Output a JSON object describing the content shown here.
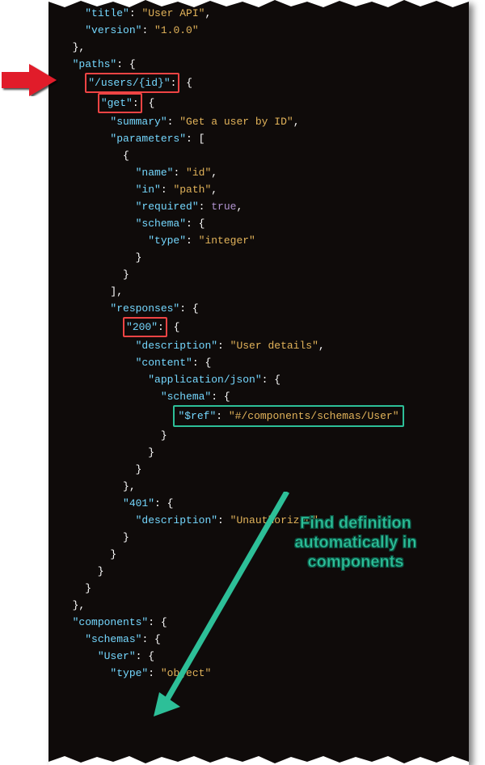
{
  "annotation": "Find definition\nautomatically in\ncomponents",
  "code_lines": [
    [
      [
        "p",
        "    "
      ],
      [
        "k",
        "\"title\""
      ],
      [
        "p",
        ": "
      ],
      [
        "s",
        "\"User API\""
      ],
      [
        "p",
        ","
      ]
    ],
    [
      [
        "p",
        "    "
      ],
      [
        "k",
        "\"version\""
      ],
      [
        "p",
        ": "
      ],
      [
        "s",
        "\"1.0.0\""
      ]
    ],
    [
      [
        "p",
        "  },"
      ]
    ],
    [
      [
        "p",
        "  "
      ],
      [
        "k",
        "\"paths\""
      ],
      [
        "p",
        ": {"
      ]
    ],
    [
      [
        "p",
        "    "
      ],
      [
        "hl-red",
        [
          [
            "k",
            "\"/users/{id}\""
          ],
          [
            "p",
            ":"
          ]
        ]
      ],
      [
        "p",
        " {"
      ]
    ],
    [
      [
        "p",
        "      "
      ],
      [
        "hl-red",
        [
          [
            "k",
            "\"get\""
          ],
          [
            "p",
            ":"
          ]
        ]
      ],
      [
        "p",
        " {"
      ]
    ],
    [
      [
        "p",
        "        "
      ],
      [
        "k",
        "\"summary\""
      ],
      [
        "p",
        ": "
      ],
      [
        "s",
        "\"Get a user by ID\""
      ],
      [
        "p",
        ","
      ]
    ],
    [
      [
        "p",
        "        "
      ],
      [
        "k",
        "\"parameters\""
      ],
      [
        "p",
        ": ["
      ]
    ],
    [
      [
        "p",
        "          {"
      ]
    ],
    [
      [
        "p",
        "            "
      ],
      [
        "k",
        "\"name\""
      ],
      [
        "p",
        ": "
      ],
      [
        "s",
        "\"id\""
      ],
      [
        "p",
        ","
      ]
    ],
    [
      [
        "p",
        "            "
      ],
      [
        "k",
        "\"in\""
      ],
      [
        "p",
        ": "
      ],
      [
        "s",
        "\"path\""
      ],
      [
        "p",
        ","
      ]
    ],
    [
      [
        "p",
        "            "
      ],
      [
        "k",
        "\"required\""
      ],
      [
        "p",
        ": "
      ],
      [
        "b",
        "true"
      ],
      [
        "p",
        ","
      ]
    ],
    [
      [
        "p",
        "            "
      ],
      [
        "k",
        "\"schema\""
      ],
      [
        "p",
        ": {"
      ]
    ],
    [
      [
        "p",
        "              "
      ],
      [
        "k",
        "\"type\""
      ],
      [
        "p",
        ": "
      ],
      [
        "s",
        "\"integer\""
      ]
    ],
    [
      [
        "p",
        "            }"
      ]
    ],
    [
      [
        "p",
        "          }"
      ]
    ],
    [
      [
        "p",
        "        ],"
      ]
    ],
    [
      [
        "p",
        "        "
      ],
      [
        "k",
        "\"responses\""
      ],
      [
        "p",
        ": {"
      ]
    ],
    [
      [
        "p",
        "          "
      ],
      [
        "hl-red",
        [
          [
            "k",
            "\"200\""
          ],
          [
            "p",
            ":"
          ]
        ]
      ],
      [
        "p",
        " {"
      ]
    ],
    [
      [
        "p",
        "            "
      ],
      [
        "k",
        "\"description\""
      ],
      [
        "p",
        ": "
      ],
      [
        "s",
        "\"User details\""
      ],
      [
        "p",
        ","
      ]
    ],
    [
      [
        "p",
        "            "
      ],
      [
        "k",
        "\"content\""
      ],
      [
        "p",
        ": {"
      ]
    ],
    [
      [
        "p",
        "              "
      ],
      [
        "k",
        "\"application/json\""
      ],
      [
        "p",
        ": {"
      ]
    ],
    [
      [
        "p",
        "                "
      ],
      [
        "k",
        "\"schema\""
      ],
      [
        "p",
        ": {"
      ]
    ],
    [
      [
        "p",
        "                  "
      ],
      [
        "hl-green",
        [
          [
            "k",
            "\"$ref\""
          ],
          [
            "p",
            ": "
          ],
          [
            "s",
            "\"#/components/schemas/User\""
          ]
        ]
      ]
    ],
    [
      [
        "p",
        "                }"
      ]
    ],
    [
      [
        "p",
        "              }"
      ]
    ],
    [
      [
        "p",
        "            }"
      ]
    ],
    [
      [
        "p",
        "          },"
      ]
    ],
    [
      [
        "p",
        "          "
      ],
      [
        "k",
        "\"401\""
      ],
      [
        "p",
        ": {"
      ]
    ],
    [
      [
        "p",
        "            "
      ],
      [
        "k",
        "\"description\""
      ],
      [
        "p",
        ": "
      ],
      [
        "s",
        "\"Unauthorized\""
      ]
    ],
    [
      [
        "p",
        "          }"
      ]
    ],
    [
      [
        "p",
        "        }"
      ]
    ],
    [
      [
        "p",
        "      }"
      ]
    ],
    [
      [
        "p",
        "    }"
      ]
    ],
    [
      [
        "p",
        "  },"
      ]
    ],
    [
      [
        "p",
        "  "
      ],
      [
        "k",
        "\"components\""
      ],
      [
        "p",
        ": {"
      ]
    ],
    [
      [
        "p",
        "    "
      ],
      [
        "k",
        "\"schemas\""
      ],
      [
        "p",
        ": {"
      ]
    ],
    [
      [
        "p",
        "      "
      ],
      [
        "k",
        "\"User\""
      ],
      [
        "p",
        ": {"
      ]
    ],
    [
      [
        "p",
        "        "
      ],
      [
        "k",
        "\"type\""
      ],
      [
        "p",
        ": "
      ],
      [
        "s",
        "\"object\""
      ]
    ]
  ]
}
